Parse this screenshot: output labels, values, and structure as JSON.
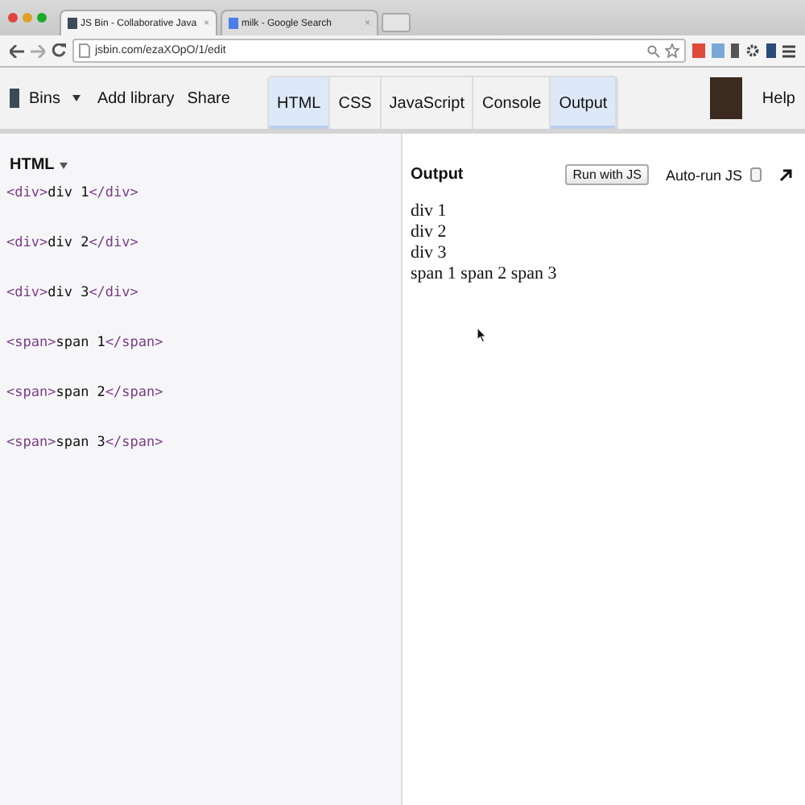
{
  "browser": {
    "tabs": [
      {
        "title": "JS Bin - Collaborative Java",
        "close": "×",
        "selected": true
      },
      {
        "title": "milk - Google Search",
        "close": "×",
        "selected": false
      }
    ],
    "address": "jsbin.com/ezaXOpO/1/edit"
  },
  "toolbar": {
    "menu": "Bins",
    "links": [
      "Add library",
      "Share"
    ],
    "panels": [
      {
        "label": "HTML",
        "selected": true
      },
      {
        "label": "CSS",
        "selected": false
      },
      {
        "label": "JavaScript",
        "selected": false
      },
      {
        "label": "Console",
        "selected": false
      },
      {
        "label": "Output",
        "selected": true
      }
    ],
    "help": "Help"
  },
  "html_panel": {
    "title": "HTML",
    "lines": [
      {
        "open": "<div>",
        "text": "div 1",
        "close": "</div>"
      },
      {
        "open": "<div>",
        "text": "div 2",
        "close": "</div>"
      },
      {
        "open": "<div>",
        "text": "div 3",
        "close": "</div>"
      },
      {
        "open": "<span>",
        "text": "span 1",
        "close": "</span>"
      },
      {
        "open": "<span>",
        "text": "span 2",
        "close": "</span>"
      },
      {
        "open": "<span>",
        "text": "span 3",
        "close": "</span>"
      }
    ]
  },
  "output_panel": {
    "title": "Output",
    "run_button": "Run with JS",
    "autorun": {
      "label": "Auto-run JS",
      "checked": false
    },
    "lines": [
      "div 1",
      "div 2",
      "div 3",
      "span 1 span 2 span 3"
    ]
  }
}
